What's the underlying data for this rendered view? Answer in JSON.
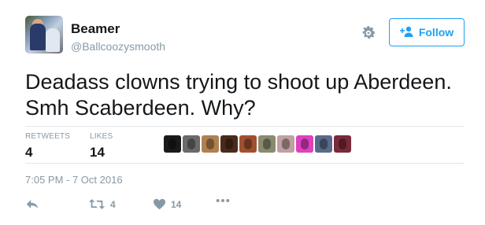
{
  "user": {
    "display_name": "Beamer",
    "handle": "@Ballcoozysmooth"
  },
  "follow_button": {
    "label": "Follow"
  },
  "tweet": {
    "text": "Deadass clowns trying to shoot up Aberdeen. Smh Scaberdeen. Why?"
  },
  "stats": {
    "retweets_label": "RETWEETS",
    "retweets_count": "4",
    "likes_label": "LIKES",
    "likes_count": "14"
  },
  "likers": [
    {
      "color": "#1a1a1a"
    },
    {
      "color": "#6a6a6a"
    },
    {
      "color": "#b08050"
    },
    {
      "color": "#4a2a1a"
    },
    {
      "color": "#a05030"
    },
    {
      "color": "#8a8a70"
    },
    {
      "color": "#c0a0a0"
    },
    {
      "color": "#e040c0"
    },
    {
      "color": "#5a6a8a"
    },
    {
      "color": "#7a2a3a"
    }
  ],
  "timestamp": "7:05 PM - 7 Oct 2016",
  "actions": {
    "reply_icon": "reply-icon",
    "retweet_icon": "retweet-icon",
    "retweet_count": "4",
    "like_icon": "heart-icon",
    "like_count": "14",
    "more_icon": "more-icon"
  },
  "colors": {
    "accent": "#1da1f2",
    "muted": "#8899a6",
    "text": "#14171a",
    "divider": "#e1e8ed"
  }
}
